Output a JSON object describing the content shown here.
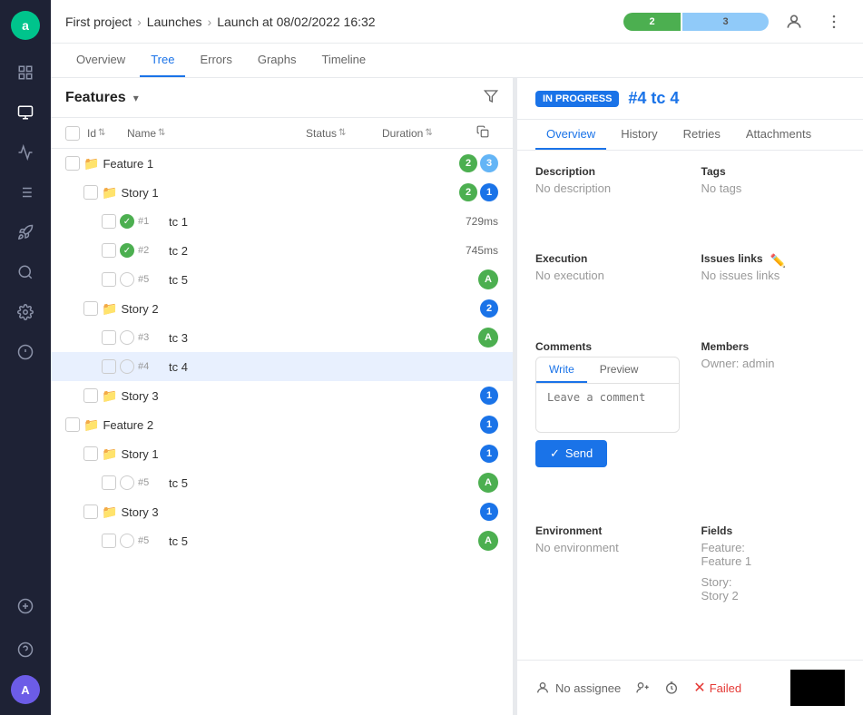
{
  "app": {
    "logo_letter": ""
  },
  "breadcrumb": {
    "project": "First project",
    "launches": "Launches",
    "launch": "Launch at 08/02/2022 16:32",
    "sep": "›"
  },
  "progress": {
    "green": "2",
    "blue": "3"
  },
  "nav_tabs": [
    {
      "id": "overview",
      "label": "Overview"
    },
    {
      "id": "tree",
      "label": "Tree",
      "active": true
    },
    {
      "id": "errors",
      "label": "Errors"
    },
    {
      "id": "graphs",
      "label": "Graphs"
    },
    {
      "id": "timeline",
      "label": "Timeline"
    }
  ],
  "features_title": "Features",
  "table_headers": {
    "id": "Id",
    "name": "Name",
    "status": "Status",
    "duration": "Duration"
  },
  "tree": [
    {
      "type": "feature",
      "indent": 0,
      "name": "Feature 1",
      "badges": [
        {
          "val": "2",
          "color": "green"
        },
        {
          "val": "3",
          "color": "blue"
        }
      ]
    },
    {
      "type": "story",
      "indent": 1,
      "name": "Story 1",
      "badges": [
        {
          "val": "2",
          "color": "green"
        },
        {
          "val": "1",
          "color": "blue"
        }
      ]
    },
    {
      "type": "tc",
      "indent": 2,
      "id": "#1",
      "name": "tc 1",
      "status": "passed",
      "duration": "729ms"
    },
    {
      "type": "tc",
      "indent": 2,
      "id": "#2",
      "name": "tc 2",
      "status": "passed",
      "duration": "745ms"
    },
    {
      "type": "tc",
      "indent": 2,
      "id": "#5",
      "name": "tc 5",
      "status": "none",
      "avatar": "A"
    },
    {
      "type": "story",
      "indent": 1,
      "name": "Story 2",
      "badges": [
        {
          "val": "2",
          "color": "blue"
        }
      ]
    },
    {
      "type": "tc",
      "indent": 2,
      "id": "#3",
      "name": "tc 3",
      "status": "none",
      "avatar": "A"
    },
    {
      "type": "tc",
      "indent": 2,
      "id": "#4",
      "name": "tc 4",
      "status": "none",
      "selected": true
    },
    {
      "type": "story",
      "indent": 1,
      "name": "Story 3",
      "badges": [
        {
          "val": "1",
          "color": "blue"
        }
      ]
    },
    {
      "type": "feature",
      "indent": 0,
      "name": "Feature 2",
      "badges": [
        {
          "val": "1",
          "color": "blue"
        }
      ]
    },
    {
      "type": "story",
      "indent": 1,
      "name": "Story 1",
      "badges": [
        {
          "val": "1",
          "color": "blue"
        }
      ]
    },
    {
      "type": "tc",
      "indent": 2,
      "id": "#5",
      "name": "tc 5",
      "status": "none",
      "avatar": "A"
    },
    {
      "type": "story",
      "indent": 1,
      "name": "Story 3",
      "badges": [
        {
          "val": "1",
          "color": "blue"
        }
      ]
    },
    {
      "type": "tc",
      "indent": 2,
      "id": "#5",
      "name": "tc 5",
      "status": "none",
      "avatar": "A"
    }
  ],
  "detail": {
    "status_badge": "IN PROGRESS",
    "title": "#4 tc 4",
    "tabs": [
      "Overview",
      "History",
      "Retries",
      "Attachments"
    ],
    "active_tab": "Overview",
    "description_label": "Description",
    "description_value": "No description",
    "tags_label": "Tags",
    "tags_value": "No tags",
    "execution_label": "Execution",
    "execution_value": "No execution",
    "issues_links_label": "Issues links",
    "issues_links_value": "No issues links",
    "comments_label": "Comments",
    "comment_write_tab": "Write",
    "comment_preview_tab": "Preview",
    "comment_placeholder": "Leave a comment",
    "send_label": "Send",
    "members_label": "Members",
    "owner_label": "Owner:",
    "owner_value": "admin",
    "environment_label": "Environment",
    "environment_value": "No environment",
    "fields_label": "Fields",
    "feature_label": "Feature:",
    "feature_value": "Feature 1",
    "story_label": "Story:",
    "story_value": "Story 2"
  },
  "bottom_bar": {
    "no_assignee": "No assignee",
    "failed_label": "Failed"
  }
}
